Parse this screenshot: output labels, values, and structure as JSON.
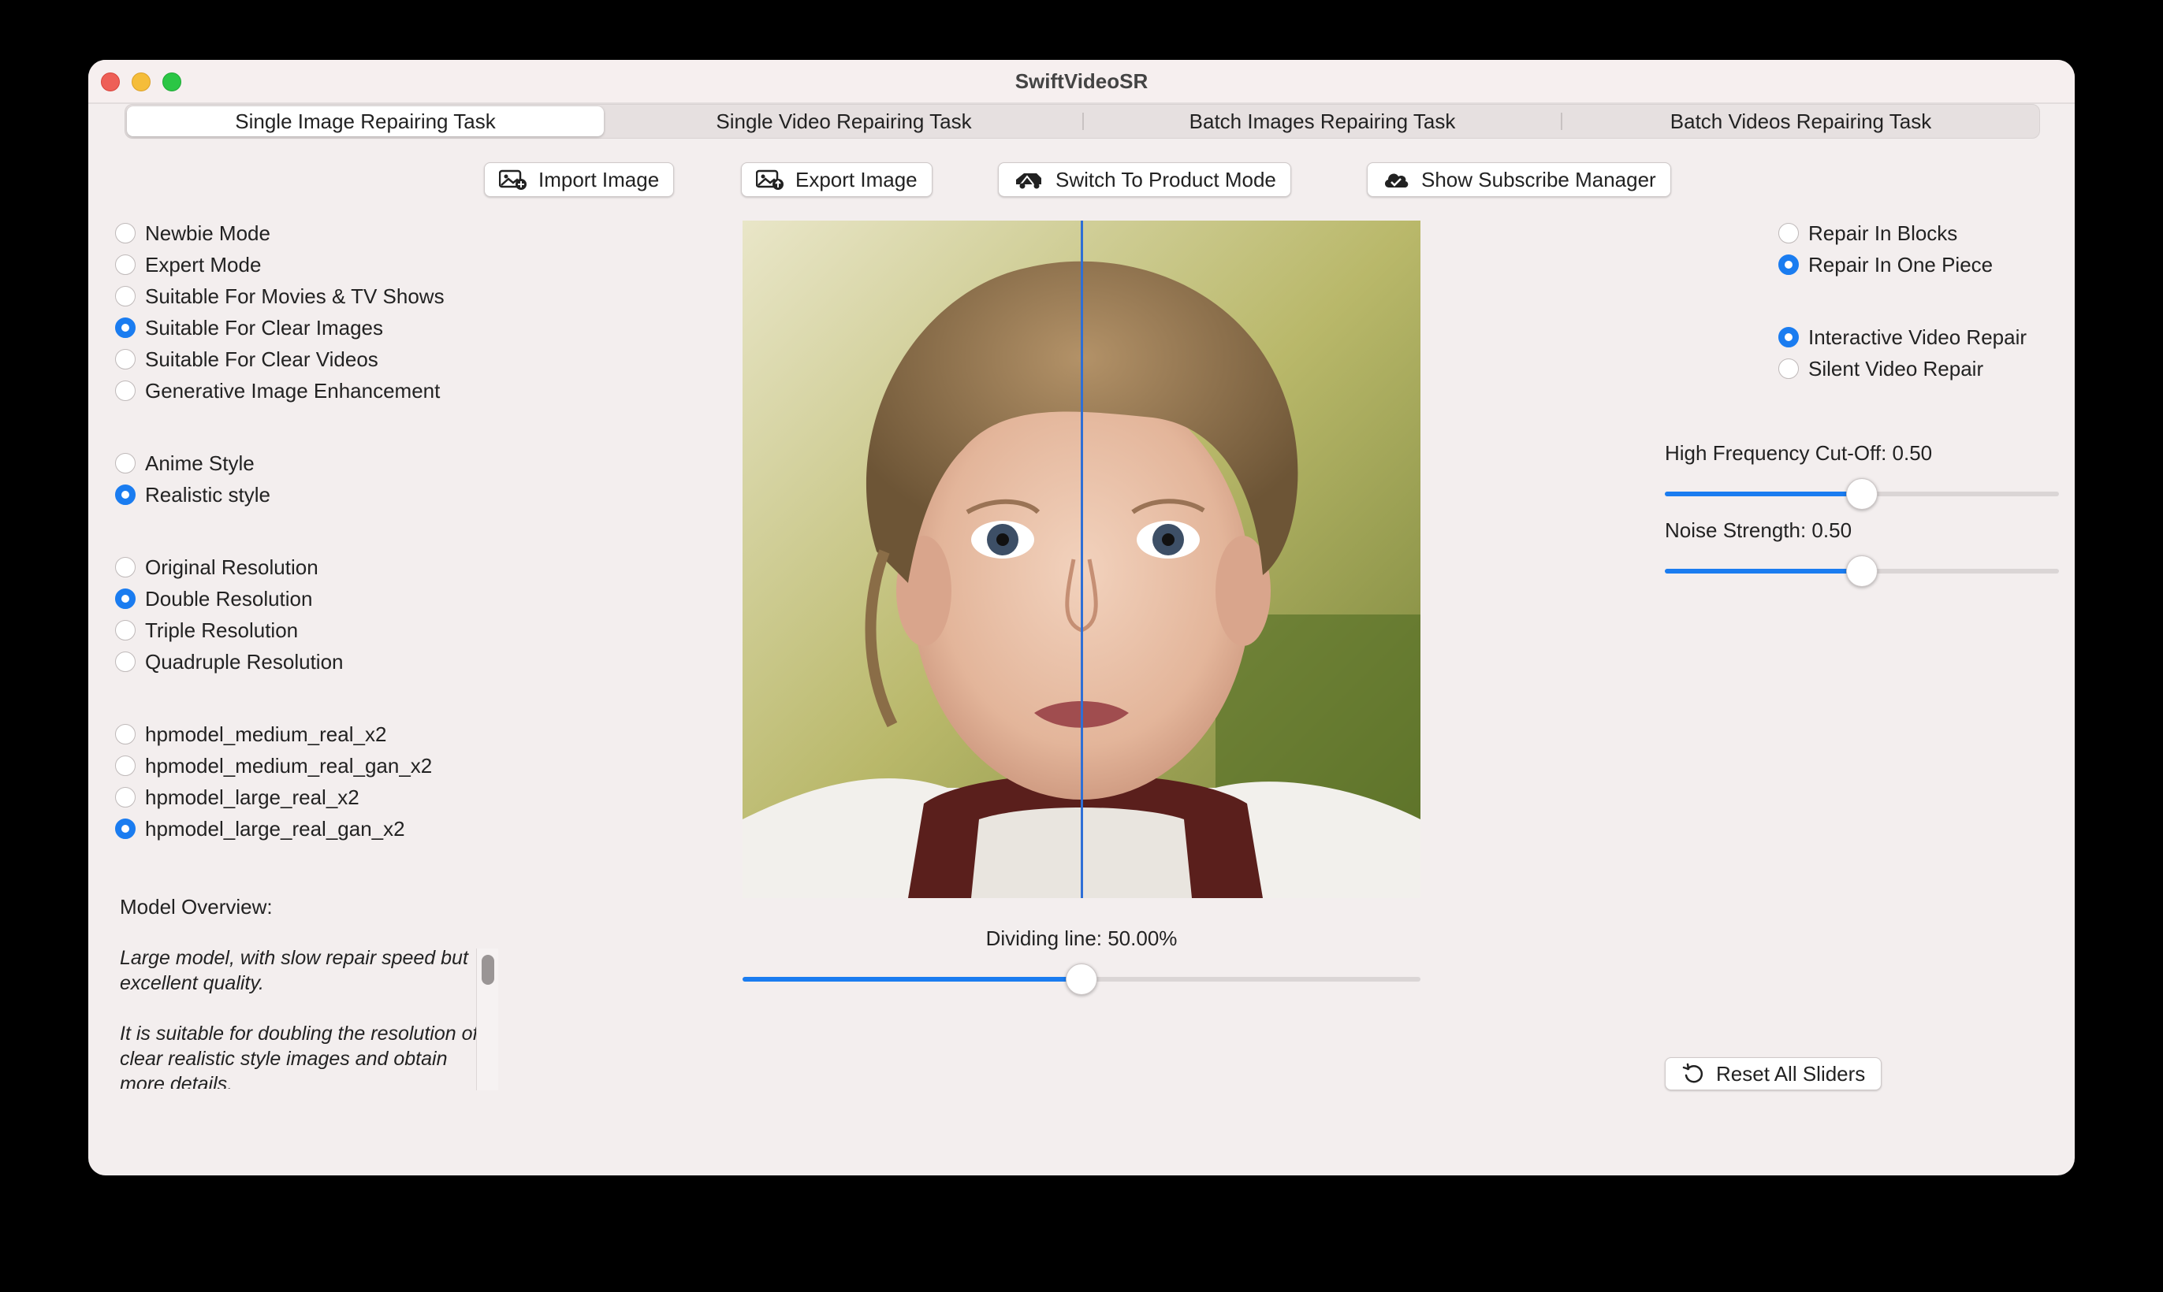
{
  "window": {
    "title": "SwiftVideoSR"
  },
  "tabs": [
    {
      "label": "Single Image Repairing Task",
      "active": true
    },
    {
      "label": "Single Video Repairing Task",
      "active": false
    },
    {
      "label": "Batch Images Repairing Task",
      "active": false
    },
    {
      "label": "Batch Videos Repairing Task",
      "active": false
    }
  ],
  "toolbar": {
    "import_label": "Import Image",
    "export_label": "Export Image",
    "switch_label": "Switch To Product Mode",
    "subscribe_label": "Show Subscribe Manager"
  },
  "mode_options": [
    {
      "label": "Newbie Mode",
      "selected": false
    },
    {
      "label": "Expert Mode",
      "selected": false
    },
    {
      "label": "Suitable For Movies & TV Shows",
      "selected": false
    },
    {
      "label": "Suitable For Clear Images",
      "selected": true
    },
    {
      "label": "Suitable For Clear Videos",
      "selected": false
    },
    {
      "label": "Generative Image Enhancement",
      "selected": false
    }
  ],
  "style_options": [
    {
      "label": "Anime Style",
      "selected": false
    },
    {
      "label": "Realistic style",
      "selected": true
    }
  ],
  "resolution_options": [
    {
      "label": "Original Resolution",
      "selected": false
    },
    {
      "label": "Double Resolution",
      "selected": true
    },
    {
      "label": "Triple Resolution",
      "selected": false
    },
    {
      "label": "Quadruple Resolution",
      "selected": false
    }
  ],
  "model_options": [
    {
      "label": "hpmodel_medium_real_x2",
      "selected": false
    },
    {
      "label": "hpmodel_medium_real_gan_x2",
      "selected": false
    },
    {
      "label": "hpmodel_large_real_x2",
      "selected": false
    },
    {
      "label": "hpmodel_large_real_gan_x2",
      "selected": true
    }
  ],
  "overview": {
    "label": "Model Overview:",
    "paragraphs": [
      "Large model, with slow repair speed but excellent quality.",
      "It is suitable for doubling the resolution of clear realistic style images and obtain more details."
    ]
  },
  "preview": {
    "divider_label": "Dividing line: 50.00%",
    "divider_value": 0.5
  },
  "repair_block_options": [
    {
      "label": "Repair In Blocks",
      "selected": false
    },
    {
      "label": "Repair In One Piece",
      "selected": true
    }
  ],
  "video_repair_options": [
    {
      "label": "Interactive Video Repair",
      "selected": true
    },
    {
      "label": "Silent Video Repair",
      "selected": false
    }
  ],
  "sliders": {
    "high_freq_label": "High Frequency Cut-Off: 0.50",
    "high_freq_value": 0.5,
    "noise_label": "Noise Strength: 0.50",
    "noise_value": 0.5
  },
  "reset": {
    "label": "Reset All Sliders"
  },
  "colors": {
    "accent": "#1a7cf0",
    "divider": "#2e6fd6"
  }
}
